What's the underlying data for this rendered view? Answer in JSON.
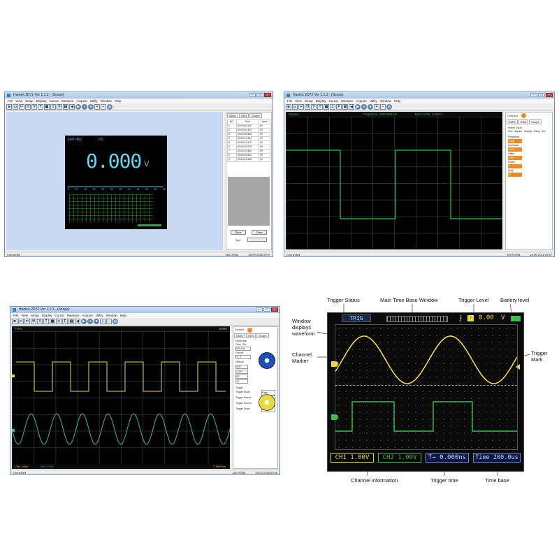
{
  "app": {
    "title": "Hantek 2D72 Ver 1.1.3 - (Scope)",
    "menu": [
      "File",
      "View",
      "Setup",
      "Display",
      "Cursor",
      "Measure",
      "Acquire",
      "Utility",
      "Window",
      "Help"
    ],
    "toolbar_icons": [
      "camera-icon",
      "folder-icon",
      "scissors-icon",
      "h-icon",
      "v-icon",
      "t-icon",
      "measure-icon",
      "math-icon",
      "fft-icon",
      "bars-icon",
      "arrow-left-icon",
      "play-icon",
      "record-icon",
      "stop-icon",
      "zoom-in-icon",
      "zoom-out-icon",
      "globe-icon"
    ]
  },
  "screen_meter": {
    "range": "[-4V~4V]",
    "coupling": "DC",
    "reading": "0.000",
    "unit": "V",
    "scale_ticks": [
      "5",
      "10",
      "15",
      "20",
      "25",
      "30",
      "35",
      "40",
      "45",
      "50",
      "55",
      "60"
    ],
    "panel_tabs": [
      "DMM",
      "GEN",
      "Scope"
    ],
    "table_headers": [
      "NO.",
      "Time",
      "Value"
    ],
    "rows": [
      [
        "1",
        "00:00:00.000",
        "0V"
      ],
      [
        "2",
        "00:00:00.493",
        "0V"
      ],
      [
        "3",
        "00:00:00.856",
        "0V"
      ],
      [
        "4",
        "00:00:01.264",
        "0V"
      ],
      [
        "5",
        "00:00:01.670",
        "0V"
      ],
      [
        "6",
        "00:00:02.075",
        "0V"
      ],
      [
        "7",
        "00:00:02.484",
        "0V"
      ],
      [
        "8",
        "00:00:02.862",
        "0V"
      ],
      [
        "9",
        "00:00:03.308",
        "0V"
      ]
    ],
    "save_label": "Save",
    "clear_label": "Clear",
    "type_label": "Type",
    "status_left": "Connected",
    "status_mid": "400.0005a",
    "status_right": "26-09-2018 09:57"
  },
  "screen_generator": {
    "header_left": "Square",
    "header_mid": "Frequency: 1000.000 Hz",
    "header_right": "50% to Pls: 3.000 V",
    "panel_tabs": [
      "DMM",
      "GEN",
      "Scope"
    ],
    "connect_label": "Connect",
    "wave_type_label": "Wave Type",
    "wave_types": [
      "Sine",
      "Square",
      "Triangle",
      "Ramp",
      "Arb"
    ],
    "param_labels": [
      "Frequency",
      "Amplitude",
      "Offset",
      "Phase",
      "Duty"
    ],
    "param_values": [
      "1.000",
      "3.000",
      "0.000",
      "0",
      "50"
    ],
    "status_left": "Connected",
    "status_mid": "400.0005a",
    "status_right": "26-09-2018 09:57"
  },
  "screen_dual": {
    "trig_label": "TRIG",
    "trig_value": "0.00V",
    "panel_tabs": [
      "DMM",
      "GEN",
      "Scope"
    ],
    "connect_label": "Connect",
    "horizontal_label": "Horizontal",
    "time_div_label": "Time / Div",
    "time_div_value": "500.0us",
    "format_label": "Format",
    "format_value": "Y - T",
    "vertical_label": "Vertical",
    "ch_value": "CH1",
    "volt_div_value": "1.00V",
    "coupling_value": "DC",
    "probe_value": "X1",
    "trigger_label": "Trigger",
    "trigger_rows": [
      [
        "Trigger Mode",
        "Edge"
      ],
      [
        "Trigger Sweep",
        "AUTO"
      ],
      [
        "Trigger Source",
        "CH1"
      ],
      [
        "Trigger Slope",
        "Rise"
      ]
    ],
    "ch1_status": "CH1  1.00V",
    "ch2_status": "CH2  1.00V",
    "time_status": "T 500.0us",
    "status_left": "Connected",
    "status_mid": "400.0005a",
    "status_right": "26-09-2018 09:58"
  },
  "device_screen": {
    "trig_status": "TRIG",
    "trigger_level_value": "0.00",
    "trigger_level_unit": "V",
    "ch1_readout": "CH1  1.00V",
    "ch2_readout": "CH2  1.00V",
    "trigger_time": "T→ 0.000ns",
    "time_base": "Time 200.0us"
  },
  "callouts": {
    "trigger_status": "Trigger Status",
    "main_time_base": "Main Time Base Window",
    "trigger_level": "Trigger Level",
    "battery_level": "Battery level",
    "window_displays": "Window displays waveform",
    "channel_marker": "Channel Marker",
    "trigger_mark": "Trigger Mark",
    "channel_information": "Channel information",
    "trigger_time": "Trigger time",
    "time_base": "Time base"
  },
  "colors": {
    "accent": "#1f5fa8",
    "ch1_yellow": "#e8dc3c",
    "ch2_green": "#36c24a",
    "lcd_cyan": "#5fd9f0",
    "title_bar": "#a9c4e4"
  }
}
